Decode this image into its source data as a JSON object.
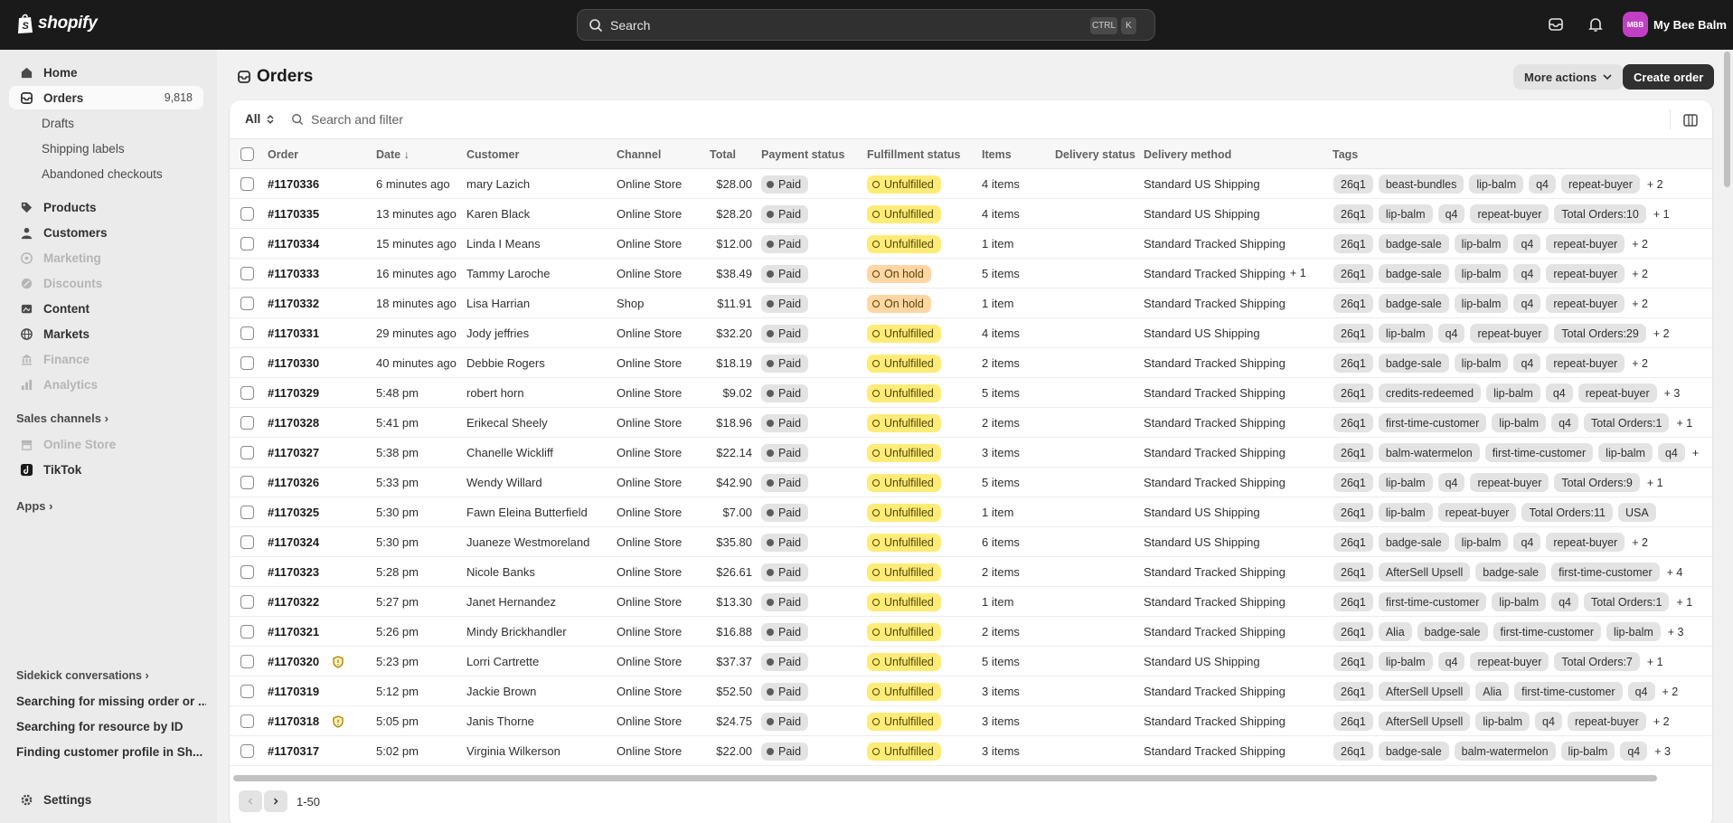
{
  "brand": "shopify",
  "search": {
    "placeholder": "Search",
    "kbd1": "CTRL",
    "kbd2": "K"
  },
  "store": {
    "initials": "MBB",
    "name": "My Bee Balm"
  },
  "sidebar": {
    "home": "Home",
    "orders": "Orders",
    "orders_count": "9,818",
    "drafts": "Drafts",
    "shipping_labels": "Shipping labels",
    "abandoned": "Abandoned checkouts",
    "products": "Products",
    "customers": "Customers",
    "marketing": "Marketing",
    "discounts": "Discounts",
    "content": "Content",
    "markets": "Markets",
    "finance": "Finance",
    "analytics": "Analytics",
    "sales_channels": "Sales channels",
    "online_store": "Online Store",
    "tiktok": "TikTok",
    "apps": "Apps",
    "sidekick_title": "Sidekick conversations",
    "sidekick_items": [
      "Searching for missing order or ...",
      "Searching for resource by ID",
      "Finding customer profile in Sh..."
    ],
    "settings": "Settings"
  },
  "page": {
    "title": "Orders",
    "more_actions": "More actions",
    "create_order": "Create order"
  },
  "filter": {
    "all": "All",
    "search_placeholder": "Search and filter"
  },
  "columns": {
    "order": "Order",
    "date": "Date ↓",
    "customer": "Customer",
    "channel": "Channel",
    "total": "Total",
    "payment": "Payment status",
    "fulfillment": "Fulfillment status",
    "items": "Items",
    "delivery_status": "Delivery status",
    "delivery_method": "Delivery method",
    "tags": "Tags"
  },
  "orders": [
    {
      "order": "#1170336",
      "date": "6 minutes ago",
      "customer": "mary Lazich",
      "channel": "Online Store",
      "total": "$28.00",
      "payment": "Paid",
      "fulfillment": "Unfulfilled",
      "items": "4 items",
      "method": "Standard US Shipping",
      "tags": [
        "26q1",
        "beast-bundles",
        "lip-balm",
        "q4",
        "repeat-buyer"
      ],
      "more": "+ 2"
    },
    {
      "order": "#1170335",
      "date": "13 minutes ago",
      "customer": "Karen Black",
      "channel": "Online Store",
      "total": "$28.20",
      "payment": "Paid",
      "fulfillment": "Unfulfilled",
      "items": "4 items",
      "method": "Standard US Shipping",
      "tags": [
        "26q1",
        "lip-balm",
        "q4",
        "repeat-buyer",
        "Total Orders:10"
      ],
      "more": "+ 1"
    },
    {
      "order": "#1170334",
      "date": "15 minutes ago",
      "customer": "Linda I Means",
      "channel": "Online Store",
      "total": "$12.00",
      "payment": "Paid",
      "fulfillment": "Unfulfilled",
      "items": "1 item",
      "method": "Standard Tracked Shipping",
      "tags": [
        "26q1",
        "badge-sale",
        "lip-balm",
        "q4",
        "repeat-buyer"
      ],
      "more": "+ 2"
    },
    {
      "order": "#1170333",
      "date": "16 minutes ago",
      "customer": "Tammy Laroche",
      "channel": "Online Store",
      "total": "$38.49",
      "payment": "Paid",
      "fulfillment": "On hold",
      "items": "5 items",
      "method": "Standard Tracked Shipping",
      "extra": "+ 1",
      "tags": [
        "26q1",
        "badge-sale",
        "lip-balm",
        "q4",
        "repeat-buyer"
      ],
      "more": "+ 2"
    },
    {
      "order": "#1170332",
      "date": "18 minutes ago",
      "customer": "Lisa Harrian",
      "channel": "Shop",
      "total": "$11.91",
      "payment": "Paid",
      "fulfillment": "On hold",
      "items": "1 item",
      "method": "Standard Tracked Shipping",
      "tags": [
        "26q1",
        "badge-sale",
        "lip-balm",
        "q4",
        "repeat-buyer"
      ],
      "more": "+ 2"
    },
    {
      "order": "#1170331",
      "date": "29 minutes ago",
      "customer": "Jody jeffries",
      "channel": "Online Store",
      "total": "$32.20",
      "payment": "Paid",
      "fulfillment": "Unfulfilled",
      "items": "4 items",
      "method": "Standard US Shipping",
      "tags": [
        "26q1",
        "lip-balm",
        "q4",
        "repeat-buyer",
        "Total Orders:29"
      ],
      "more": "+ 2"
    },
    {
      "order": "#1170330",
      "date": "40 minutes ago",
      "customer": "Debbie Rogers",
      "channel": "Online Store",
      "total": "$18.19",
      "payment": "Paid",
      "fulfillment": "Unfulfilled",
      "items": "2 items",
      "method": "Standard Tracked Shipping",
      "tags": [
        "26q1",
        "badge-sale",
        "lip-balm",
        "q4",
        "repeat-buyer"
      ],
      "more": "+ 2"
    },
    {
      "order": "#1170329",
      "date": "5:48 pm",
      "customer": "robert horn",
      "channel": "Online Store",
      "total": "$9.02",
      "payment": "Paid",
      "fulfillment": "Unfulfilled",
      "items": "5 items",
      "method": "Standard Tracked Shipping",
      "tags": [
        "26q1",
        "credits-redeemed",
        "lip-balm",
        "q4",
        "repeat-buyer"
      ],
      "more": "+ 3"
    },
    {
      "order": "#1170328",
      "date": "5:41 pm",
      "customer": "Erikecal Sheely",
      "channel": "Online Store",
      "total": "$18.96",
      "payment": "Paid",
      "fulfillment": "Unfulfilled",
      "items": "2 items",
      "method": "Standard Tracked Shipping",
      "tags": [
        "26q1",
        "first-time-customer",
        "lip-balm",
        "q4",
        "Total Orders:1"
      ],
      "more": "+ 1"
    },
    {
      "order": "#1170327",
      "date": "5:38 pm",
      "customer": "Chanelle Wickliff",
      "channel": "Online Store",
      "total": "$22.14",
      "payment": "Paid",
      "fulfillment": "Unfulfilled",
      "items": "3 items",
      "method": "Standard Tracked Shipping",
      "tags": [
        "26q1",
        "balm-watermelon",
        "first-time-customer",
        "lip-balm",
        "q4"
      ],
      "more": "+"
    },
    {
      "order": "#1170326",
      "date": "5:33 pm",
      "customer": "Wendy Willard",
      "channel": "Online Store",
      "total": "$42.90",
      "payment": "Paid",
      "fulfillment": "Unfulfilled",
      "items": "5 items",
      "method": "Standard Tracked Shipping",
      "tags": [
        "26q1",
        "lip-balm",
        "q4",
        "repeat-buyer",
        "Total Orders:9"
      ],
      "more": "+ 1"
    },
    {
      "order": "#1170325",
      "date": "5:30 pm",
      "customer": "Fawn Eleina Butterfield",
      "channel": "Online Store",
      "total": "$7.00",
      "payment": "Paid",
      "fulfillment": "Unfulfilled",
      "items": "1 item",
      "method": "Standard US Shipping",
      "tags": [
        "26q1",
        "lip-balm",
        "repeat-buyer",
        "Total Orders:11",
        "USA"
      ],
      "more": ""
    },
    {
      "order": "#1170324",
      "date": "5:30 pm",
      "customer": "Juaneze Westmoreland",
      "channel": "Online Store",
      "total": "$35.80",
      "payment": "Paid",
      "fulfillment": "Unfulfilled",
      "items": "6 items",
      "method": "Standard US Shipping",
      "tags": [
        "26q1",
        "badge-sale",
        "lip-balm",
        "q4",
        "repeat-buyer"
      ],
      "more": "+ 2"
    },
    {
      "order": "#1170323",
      "date": "5:28 pm",
      "customer": "Nicole Banks",
      "channel": "Online Store",
      "total": "$26.61",
      "payment": "Paid",
      "fulfillment": "Unfulfilled",
      "items": "2 items",
      "method": "Standard Tracked Shipping",
      "tags": [
        "26q1",
        "AfterSell Upsell",
        "badge-sale",
        "first-time-customer"
      ],
      "more": "+ 4"
    },
    {
      "order": "#1170322",
      "date": "5:27 pm",
      "customer": "Janet Hernandez",
      "channel": "Online Store",
      "total": "$13.30",
      "payment": "Paid",
      "fulfillment": "Unfulfilled",
      "items": "1 item",
      "method": "Standard Tracked Shipping",
      "tags": [
        "26q1",
        "first-time-customer",
        "lip-balm",
        "q4",
        "Total Orders:1"
      ],
      "more": "+ 1"
    },
    {
      "order": "#1170321",
      "date": "5:26 pm",
      "customer": "Mindy Brickhandler",
      "channel": "Online Store",
      "total": "$16.88",
      "payment": "Paid",
      "fulfillment": "Unfulfilled",
      "items": "2 items",
      "method": "Standard Tracked Shipping",
      "tags": [
        "26q1",
        "Alia",
        "badge-sale",
        "first-time-customer",
        "lip-balm"
      ],
      "more": "+ 3"
    },
    {
      "order": "#1170320",
      "date": "5:23 pm",
      "customer": "Lorri Cartrette",
      "channel": "Online Store",
      "total": "$37.37",
      "payment": "Paid",
      "fulfillment": "Unfulfilled",
      "items": "5 items",
      "method": "Standard US Shipping",
      "warn": true,
      "tags": [
        "26q1",
        "lip-balm",
        "q4",
        "repeat-buyer",
        "Total Orders:7"
      ],
      "more": "+ 1"
    },
    {
      "order": "#1170319",
      "date": "5:12 pm",
      "customer": "Jackie Brown",
      "channel": "Online Store",
      "total": "$52.50",
      "payment": "Paid",
      "fulfillment": "Unfulfilled",
      "items": "3 items",
      "method": "Standard Tracked Shipping",
      "tags": [
        "26q1",
        "AfterSell Upsell",
        "Alia",
        "first-time-customer",
        "q4"
      ],
      "more": "+ 2"
    },
    {
      "order": "#1170318",
      "date": "5:05 pm",
      "customer": "Janis Thorne",
      "channel": "Online Store",
      "total": "$24.75",
      "payment": "Paid",
      "fulfillment": "Unfulfilled",
      "items": "3 items",
      "method": "Standard Tracked Shipping",
      "warn": true,
      "tags": [
        "26q1",
        "AfterSell Upsell",
        "lip-balm",
        "q4",
        "repeat-buyer"
      ],
      "more": "+ 2"
    },
    {
      "order": "#1170317",
      "date": "5:02 pm",
      "customer": "Virginia Wilkerson",
      "channel": "Online Store",
      "total": "$22.00",
      "payment": "Paid",
      "fulfillment": "Unfulfilled",
      "items": "3 items",
      "method": "Standard Tracked Shipping",
      "tags": [
        "26q1",
        "badge-sale",
        "balm-watermelon",
        "lip-balm",
        "q4"
      ],
      "more": "+ 3"
    }
  ],
  "pagination": {
    "range": "1-50"
  },
  "colors": {
    "topbar": "#1a1a1a",
    "unfulfilled": "#ffeb78",
    "on_hold": "#ffd6a4",
    "paid": "#e3e3e3",
    "avatar": "#c13fc4"
  }
}
